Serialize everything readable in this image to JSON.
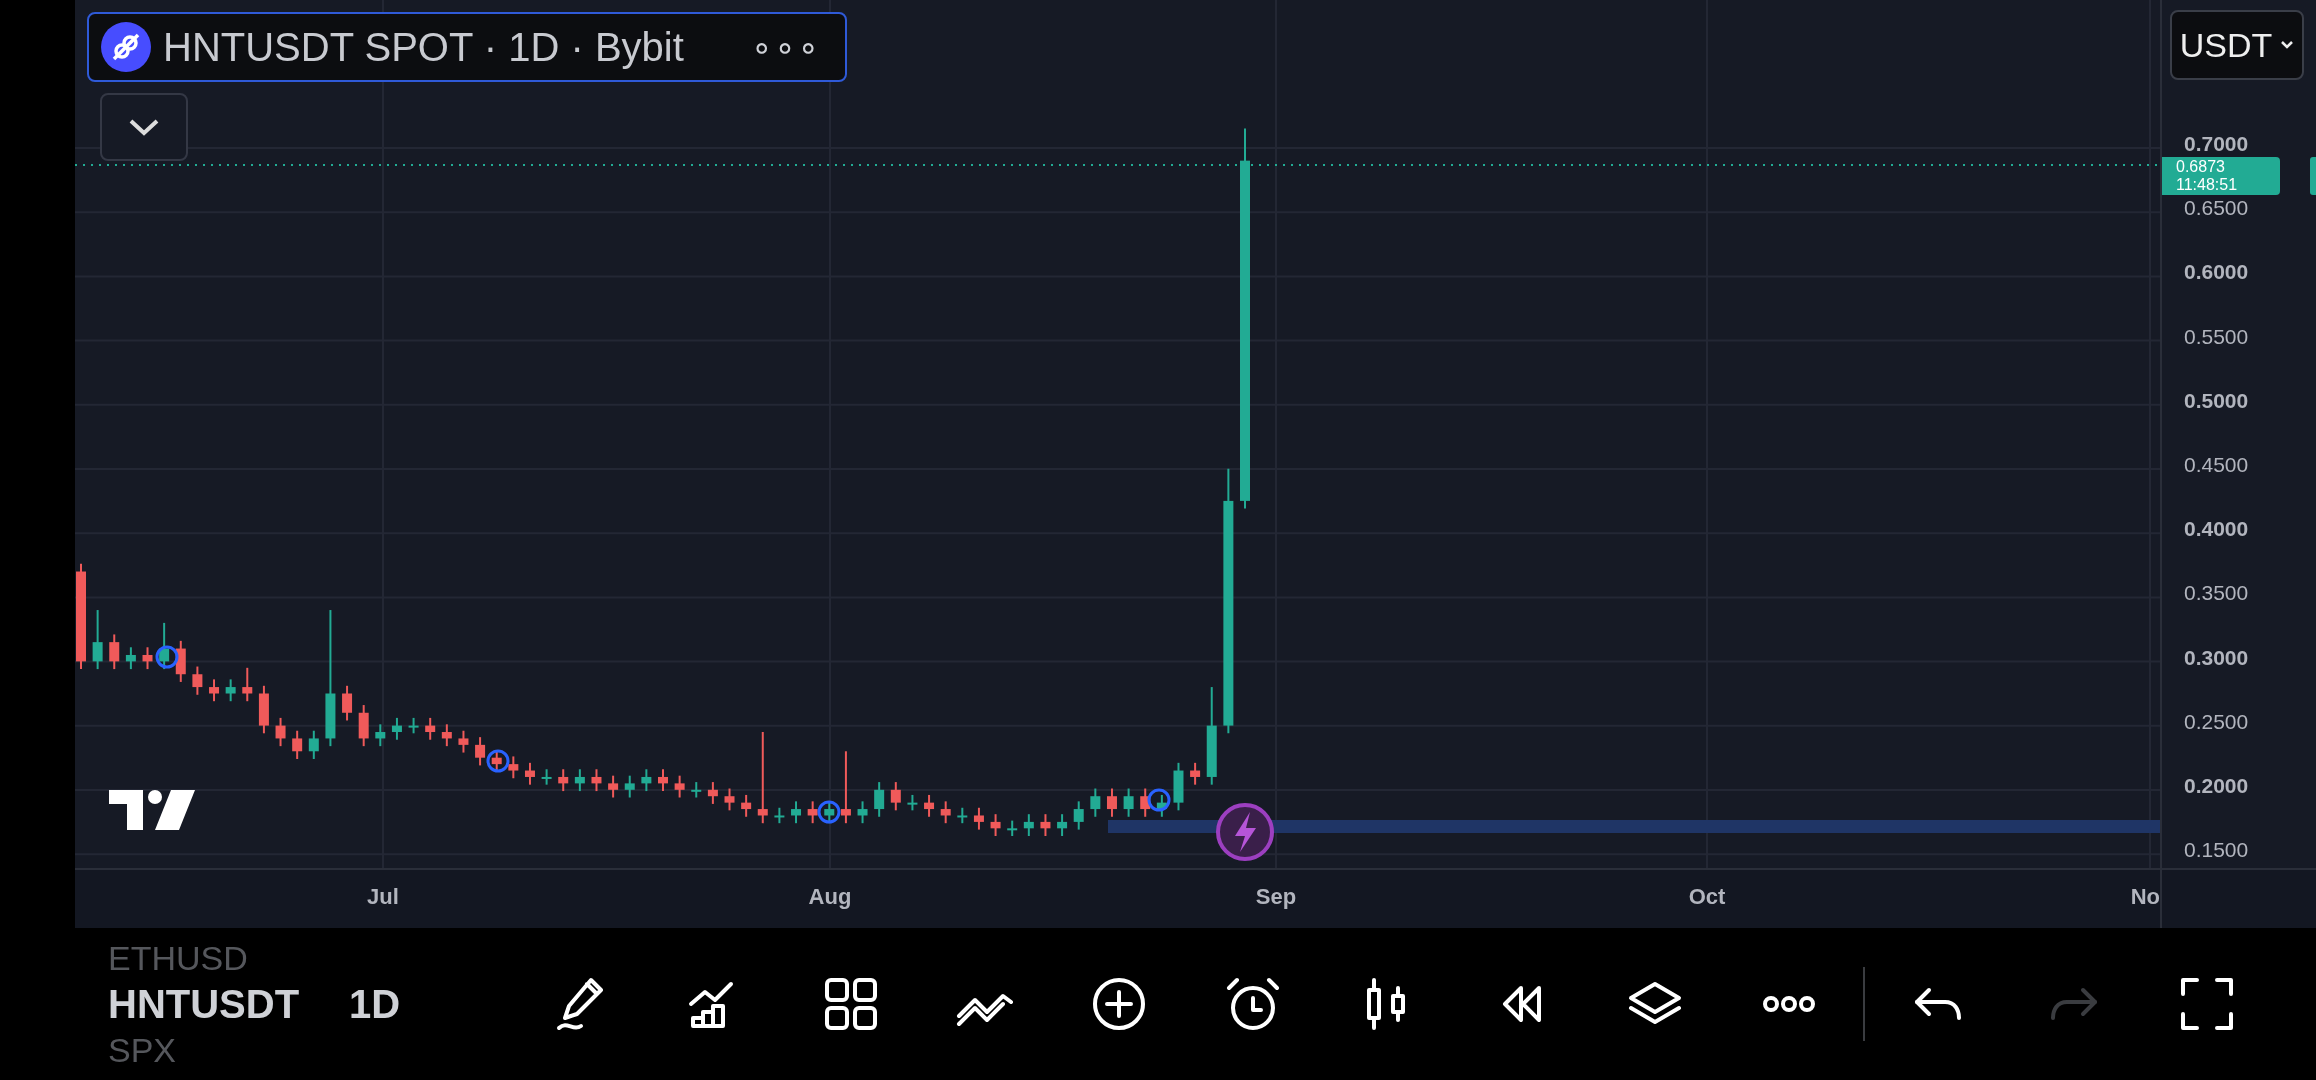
{
  "header": {
    "title": "HNTUSDT SPOT · 1D · Bybit",
    "more": "∘∘∘"
  },
  "currency_button": "USDT",
  "price_axis": {
    "ticks": [
      {
        "label": "0.7000",
        "major": true
      },
      {
        "label": "0.6500",
        "major": false
      },
      {
        "label": "0.6000",
        "major": true
      },
      {
        "label": "0.5500",
        "major": false
      },
      {
        "label": "0.5000",
        "major": true
      },
      {
        "label": "0.4500",
        "major": false
      },
      {
        "label": "0.4000",
        "major": true
      },
      {
        "label": "0.3500",
        "major": false
      },
      {
        "label": "0.3000",
        "major": true
      },
      {
        "label": "0.2500",
        "major": false
      },
      {
        "label": "0.2000",
        "major": true
      },
      {
        "label": "0.1500",
        "major": false
      }
    ]
  },
  "last_price": {
    "price": "0.6873",
    "countdown": "11:48:51"
  },
  "time_axis": [
    "Jul",
    "Aug",
    "Sep",
    "Oct",
    "No"
  ],
  "symbol_picker": {
    "items": [
      {
        "label": "ETHUSD",
        "selected": false
      },
      {
        "label": "HNTUSDT",
        "selected": true
      },
      {
        "label": "SPX",
        "selected": false
      }
    ],
    "interval": "1D"
  },
  "toolbar": [
    {
      "kind": "pencil",
      "disabled": false
    },
    {
      "kind": "indicators",
      "disabled": false
    },
    {
      "kind": "grid",
      "disabled": false
    },
    {
      "kind": "wave",
      "disabled": false
    },
    {
      "kind": "plus",
      "disabled": false
    },
    {
      "kind": "alarm",
      "disabled": false
    },
    {
      "kind": "candles",
      "disabled": false
    },
    {
      "kind": "rewind",
      "disabled": false
    },
    {
      "kind": "layers",
      "disabled": false
    },
    {
      "kind": "more",
      "disabled": false
    },
    {
      "kind": "divider"
    },
    {
      "kind": "undo",
      "disabled": false
    },
    {
      "kind": "redo",
      "disabled": true
    },
    {
      "kind": "fullscreen",
      "disabled": false
    }
  ]
}
